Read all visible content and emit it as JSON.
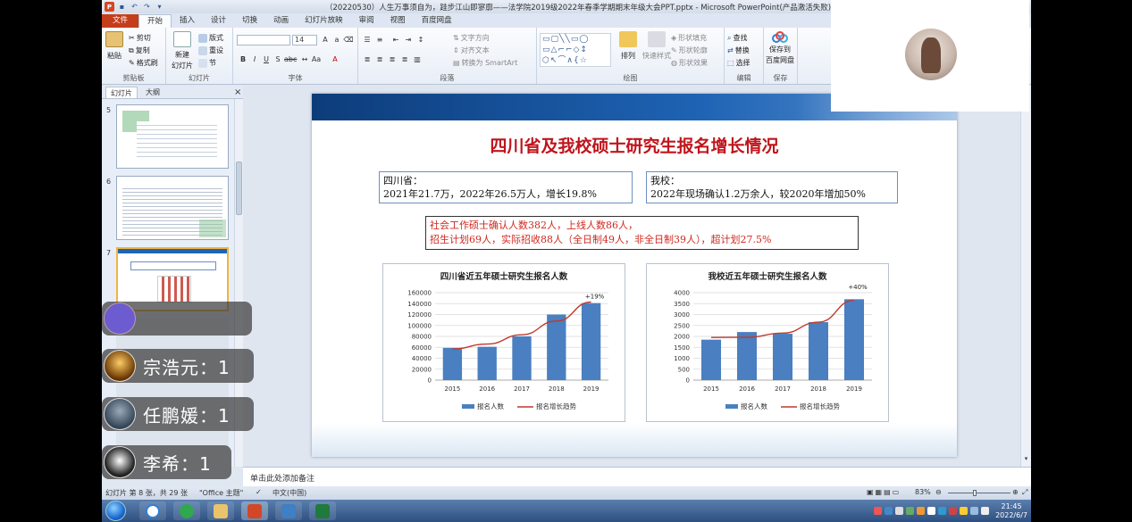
{
  "window": {
    "title": "（20220530）人生万事须自为，跬步江山即寥廓——法学院2019级2022年春季学期期末年级大会PPT.pptx - Microsoft PowerPoint(产品激活失败)"
  },
  "tabs": [
    "文件",
    "开始",
    "插入",
    "设计",
    "切换",
    "动画",
    "幻灯片放映",
    "审阅",
    "视图",
    "百度网盘"
  ],
  "ribbon": {
    "clipboard": {
      "paste": "粘贴",
      "cut": "剪切",
      "copy": "复制",
      "format_painter": "格式刷",
      "label": "剪贴板"
    },
    "slides": {
      "new_slide": "新建",
      "new_slide2": "幻灯片",
      "layout": "版式",
      "reset": "重设",
      "section": "节",
      "label": "幻灯片"
    },
    "font": {
      "size": "14",
      "label": "字体"
    },
    "paragraph": {
      "text_direction": "文字方向",
      "align_text": "对齐文本",
      "smartart": "转换为 SmartArt",
      "label": "段落"
    },
    "drawing": {
      "arrange": "排列",
      "quick_styles": "快速样式",
      "shape_fill": "形状填充",
      "shape_outline": "形状轮廓",
      "shape_effects": "形状效果",
      "label": "绘图"
    },
    "editing": {
      "find": "查找",
      "replace": "替换",
      "select": "选择",
      "label": "编辑"
    },
    "save": {
      "save_to": "保存到",
      "baidu": "百度网盘",
      "label": "保存"
    }
  },
  "pane": {
    "tab_slides": "幻灯片",
    "tab_outline": "大纲",
    "close": "×",
    "thumbs": [
      {
        "num": "5"
      },
      {
        "num": "6"
      },
      {
        "num": "7"
      }
    ]
  },
  "slide": {
    "title": "四川省及我校硕士研究生报名增长情况",
    "box_sichuan": {
      "line1": "四川省：",
      "line2": "2021年21.7万，2022年26.5万人，增长19.8%"
    },
    "box_school": {
      "line1": "我校：",
      "line2": "2022年现场确认1.2万余人，较2020年增加50%"
    },
    "box_social": {
      "line1": "社会工作硕士确认人数382人，上线人数86人，",
      "line2": "招生计划69人，实际招收88人（全日制49人，非全日制39人），超计划27.5%"
    }
  },
  "chart_data": [
    {
      "type": "bar",
      "title": "四川省近五年硕士研究生报名人数",
      "categories": [
        "2015",
        "2016",
        "2017",
        "2018",
        "2019"
      ],
      "series": [
        {
          "name": "报名人数",
          "values": [
            59000,
            61000,
            80000,
            120000,
            141000
          ]
        },
        {
          "name": "报名增长趋势",
          "type": "line",
          "values": [
            57000,
            66000,
            83000,
            108000,
            143000
          ]
        }
      ],
      "yticks": [
        "0",
        "20000",
        "40000",
        "60000",
        "80000",
        "100000",
        "120000",
        "140000",
        "160000"
      ],
      "ylim": [
        0,
        160000
      ],
      "annotation": "+19%",
      "legend_position": "bottom",
      "colors": {
        "bar": "#4a7fc1",
        "line": "#c0392b"
      }
    },
    {
      "type": "bar",
      "title": "我校近五年硕士研究生报名人数",
      "categories": [
        "2015",
        "2016",
        "2017",
        "2018",
        "2019"
      ],
      "series": [
        {
          "name": "报名人数",
          "values": [
            1850,
            2200,
            2120,
            2650,
            3700
          ]
        },
        {
          "name": "报名增长趋势",
          "type": "line",
          "values": [
            1950,
            1960,
            2150,
            2650,
            3650
          ]
        }
      ],
      "yticks": [
        "0",
        "500",
        "1000",
        "1500",
        "2000",
        "2500",
        "3000",
        "3500",
        "4000"
      ],
      "ylim": [
        0,
        4000
      ],
      "annotation": "+40%",
      "legend_position": "bottom",
      "colors": {
        "bar": "#4a7fc1",
        "line": "#c0392b"
      }
    }
  ],
  "notes": {
    "placeholder": "单击此处添加备注"
  },
  "status": {
    "slide_info": "幻灯片 第 8 张，共 29 张",
    "theme": "\"Office 主题\"",
    "language": "中文(中国)",
    "zoom": "83%"
  },
  "taskbar": {
    "time": "21:45",
    "date": "2022/6/7"
  },
  "danmu": [
    {
      "text": "宗浩元：1"
    },
    {
      "text": "任鹏媛：1"
    },
    {
      "text": "李希：1"
    }
  ]
}
